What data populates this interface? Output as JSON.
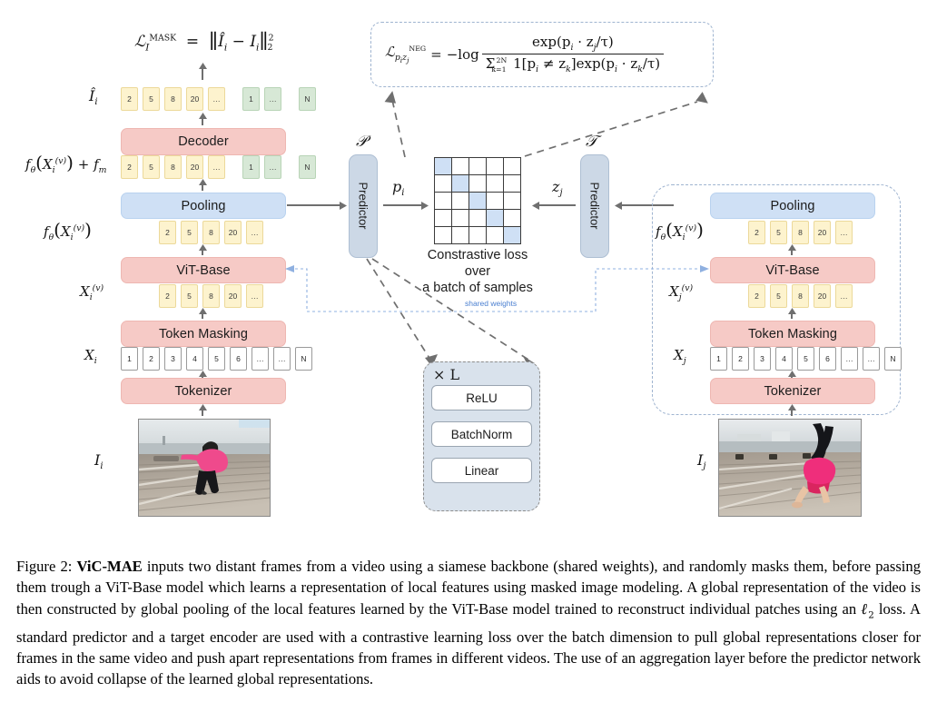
{
  "figure": {
    "number": "Figure 2:",
    "title": "ViC-MAE",
    "caption_rest": " inputs two distant frames from a video using a siamese backbone (shared weights), and randomly masks them, before passing them trough a ViT-Base model which learns a representation of local features using masked image modeling. A global representation of the video is then constructed by global pooling of the local features learned by the ViT-Base model trained to reconstruct individual patches using an ",
    "caption_l2": "ℓ",
    "caption_l2_sub": "2",
    "caption_tail": " loss. A standard predictor and a target encoder are used with a contrastive learning loss over the batch dimension to pull global representations closer for frames in the same video and push apart representations from frames in different videos. The use of an aggregation layer before the predictor network aids to avoid collapse of the learned global representations."
  },
  "losses": {
    "mask_loss": "ℒ_I^MASK = ‖ Î_i − I_i ‖²₂",
    "neg_loss": "ℒ_{p_i z_j}^NEG = −log exp(p_i · z_j/τ) / Σ_{k=1}^{2N} 1[p_i ≠ z_k] exp(p_i · z_k/τ)"
  },
  "left_branch": {
    "input_label": "I_i",
    "blocks": [
      {
        "name": "tokenizer",
        "label": "Tokenizer",
        "color": "pink"
      },
      {
        "name": "token-masking",
        "label": "Token Masking",
        "color": "pink"
      },
      {
        "name": "vit-base",
        "label": "ViT-Base",
        "color": "pink"
      },
      {
        "name": "pooling",
        "label": "Pooling",
        "color": "blue"
      },
      {
        "name": "decoder",
        "label": "Decoder",
        "color": "pink"
      }
    ],
    "labels": {
      "x_i": "X_i",
      "x_i_v": "X_i^(v)",
      "f_theta_x": "f_θ(X_i^(v))",
      "f_theta_x_plus_fm": "f_θ(X_i^(v)) + f_m",
      "i_hat": "Î_i"
    },
    "tokens_x": [
      "1",
      "2",
      "3",
      "4",
      "5",
      "6",
      "…",
      "…",
      "N"
    ],
    "tokens_masked": [
      "2",
      "5",
      "8",
      "20",
      "…"
    ],
    "tokens_features": [
      "2",
      "5",
      "8",
      "20",
      "…"
    ],
    "tokens_decoder_in_yellow": [
      "2",
      "5",
      "8",
      "20",
      "…"
    ],
    "tokens_decoder_in_green": [
      "1",
      "…",
      "N"
    ],
    "tokens_recon_yellow": [
      "2",
      "5",
      "8",
      "20",
      "…"
    ],
    "tokens_recon_green": [
      "1",
      "…",
      "N"
    ]
  },
  "right_branch": {
    "input_label": "I_j",
    "blocks": [
      {
        "name": "tokenizer",
        "label": "Tokenizer",
        "color": "pink"
      },
      {
        "name": "token-masking",
        "label": "Token Masking",
        "color": "pink"
      },
      {
        "name": "vit-base",
        "label": "ViT-Base",
        "color": "pink"
      },
      {
        "name": "pooling",
        "label": "Pooling",
        "color": "blue"
      }
    ],
    "labels": {
      "x_j": "X_j",
      "x_j_v": "X_j^(v)",
      "f_theta_x": "f_θ(X_i^(v))"
    },
    "tokens_x": [
      "1",
      "2",
      "3",
      "4",
      "5",
      "6",
      "…",
      "…",
      "N"
    ],
    "tokens_masked": [
      "2",
      "5",
      "8",
      "20",
      "…"
    ],
    "tokens_features": [
      "2",
      "5",
      "8",
      "20",
      "…"
    ]
  },
  "center": {
    "predictor_p_symbol": "𝒫",
    "predictor_t_symbol": "𝒯",
    "predictor_label_left": "Predictor",
    "predictor_label_right": "Predictor",
    "p_i": "p_i",
    "z_j": "z_j",
    "matrix_caption_line1": "Constrastive loss over",
    "matrix_caption_line2": "a batch of samples",
    "matrix_size": 5,
    "matrix_highlight": "diagonal",
    "shared_weights_label": "shared weights"
  },
  "mlp": {
    "times_label": "× L",
    "items": [
      "ReLU",
      "BatchNorm",
      "Linear"
    ]
  },
  "colors": {
    "pink_block": "#f6cac6",
    "blue_block": "#cfe0f5",
    "yellow_token": "#fdf3ce",
    "green_token": "#d7e8d6",
    "white_token": "#ffffff",
    "predictor": "#ccd8e6",
    "mlp_bg": "#d9e2ec",
    "shared_weights_text": "#4a7fd0",
    "matrix_highlight": "#cfe0f5"
  }
}
